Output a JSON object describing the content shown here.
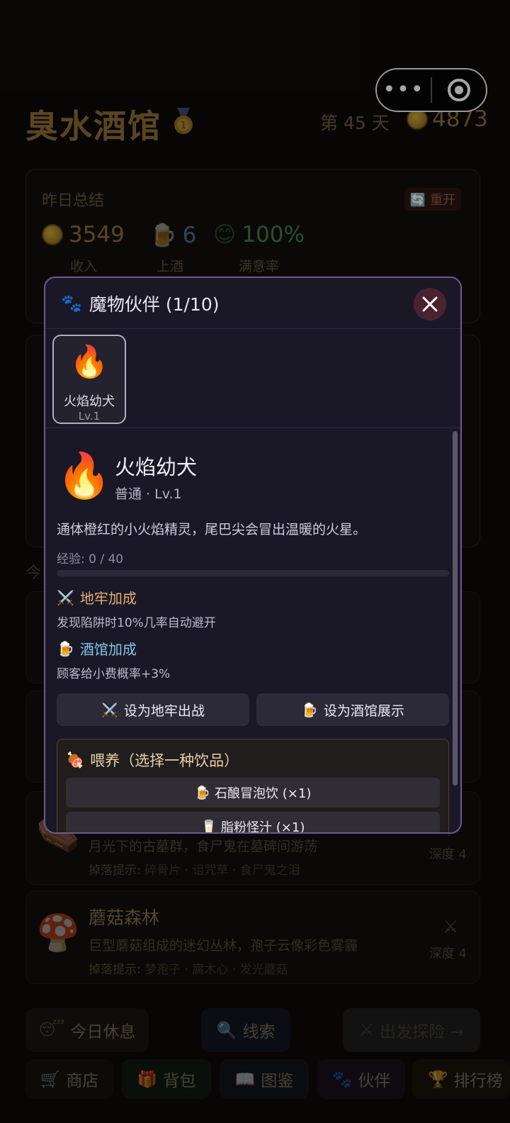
{
  "header": {
    "title": "臭水酒馆",
    "day_text": "第 45 天",
    "coins": "4873"
  },
  "summary": {
    "label": "昨日总结",
    "reopen": "重开",
    "income": {
      "value": "3549",
      "caption": "收入"
    },
    "served": {
      "value": "6",
      "caption": "上酒"
    },
    "satisfaction": {
      "value": "100%",
      "caption": "满意率"
    }
  },
  "today_label": "今",
  "dungeons": [
    {
      "name": "",
      "desc": "月光下的古墓群，食尸鬼在墓碑间游荡",
      "drops_label": "掉落提示:",
      "drops": "碎骨片 · 诅咒草 · 食尸鬼之泪",
      "depth": "深度 4"
    },
    {
      "name": "蘑菇森林",
      "desc": "巨型蘑菇组成的迷幻丛林，孢子云像彩色雾霾",
      "drops_label": "掉落提示:",
      "drops": "梦孢子 · 腐木心 · 发光蘑菇",
      "depth": "深度 4"
    }
  ],
  "actions": {
    "rest": "今日休息",
    "clue": "线索",
    "explore": "出发探险 →"
  },
  "nav": [
    "商店",
    "背包",
    "图鉴",
    "伙伴",
    "排行榜"
  ],
  "modal": {
    "title": "魔物伙伴 (1/10)",
    "thumb": {
      "name": "火焰幼犬",
      "level": "Lv.1"
    },
    "pet": {
      "name": "火焰幼犬",
      "rank": "普通 · Lv.1",
      "desc": "通体橙红的小火焰精灵，尾巴尖会冒出温暖的火星。",
      "exp_text": "经验:  0 / 40",
      "exp_progress": 0.0
    },
    "dungeon_bonus": {
      "title": "地牢加成",
      "desc": "发现陷阱时10%几率自动避开"
    },
    "tavern_bonus": {
      "title": "酒馆加成",
      "desc": "顾客给小费概率+3%"
    },
    "buttons": {
      "set_dungeon": "设为地牢出战",
      "set_tavern": "设为酒馆展示"
    },
    "feed": {
      "title": "喂养（选择一种饮品）",
      "drinks": [
        "石酿冒泡饮 (×1)",
        "脂粉怪汁 (×1)"
      ]
    }
  },
  "colors": {
    "accent_purple": "#6a5a90",
    "gold": "#8a6a33",
    "dungeon_bonus": "#e0b070",
    "tavern_bonus": "#7fc7e8"
  }
}
